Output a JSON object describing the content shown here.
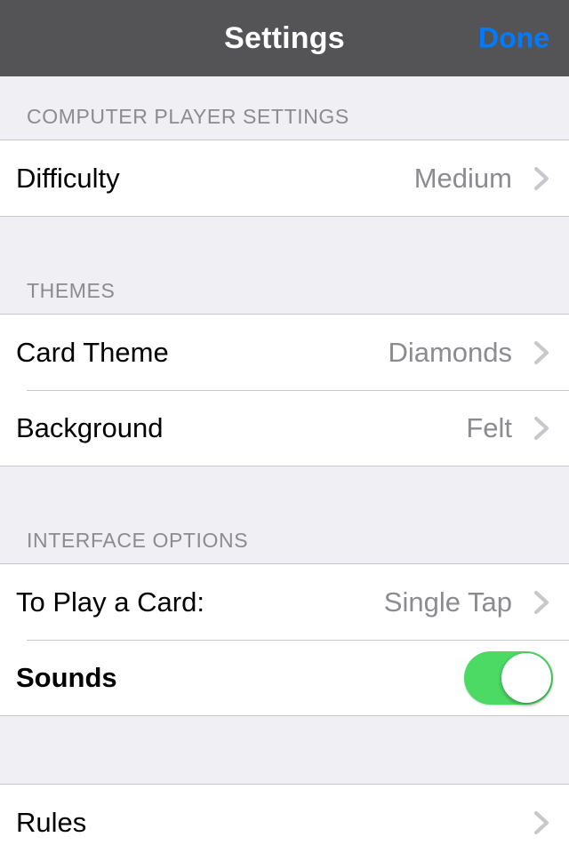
{
  "navbar": {
    "title": "Settings",
    "done_label": "Done",
    "background_color": "#545457",
    "title_color": "#FFFFFF",
    "done_color": "#007AFF"
  },
  "colors": {
    "group_background": "#FFFFFF",
    "table_background": "#EFEFF4",
    "separator": "#C8C7CC",
    "secondary_text": "#8B8B90",
    "primary_text": "#000000",
    "switch_on": "#4CD964"
  },
  "sections": [
    {
      "header": "COMPUTER PLAYER SETTINGS",
      "rows": [
        {
          "label": "Difficulty",
          "value": "Medium",
          "accessory": "chevron-right-icon",
          "name": "difficulty"
        }
      ]
    },
    {
      "header": "THEMES",
      "rows": [
        {
          "label": "Card Theme",
          "value": "Diamonds",
          "accessory": "chevron-right-icon",
          "name": "card-theme"
        },
        {
          "label": "Background",
          "value": "Felt",
          "accessory": "chevron-right-icon",
          "name": "background"
        }
      ]
    },
    {
      "header": "INTERFACE OPTIONS",
      "rows": [
        {
          "label": "To Play a Card:",
          "value": "Single Tap",
          "accessory": "chevron-right-icon",
          "name": "to-play-a-card"
        },
        {
          "label": "Sounds",
          "value": "",
          "accessory": "toggle-switch",
          "switch_state": "on",
          "bold": true,
          "name": "sounds"
        }
      ]
    },
    {
      "header": "",
      "rows": [
        {
          "label": "Rules",
          "value": "",
          "accessory": "chevron-right-icon",
          "name": "rules"
        }
      ]
    }
  ]
}
